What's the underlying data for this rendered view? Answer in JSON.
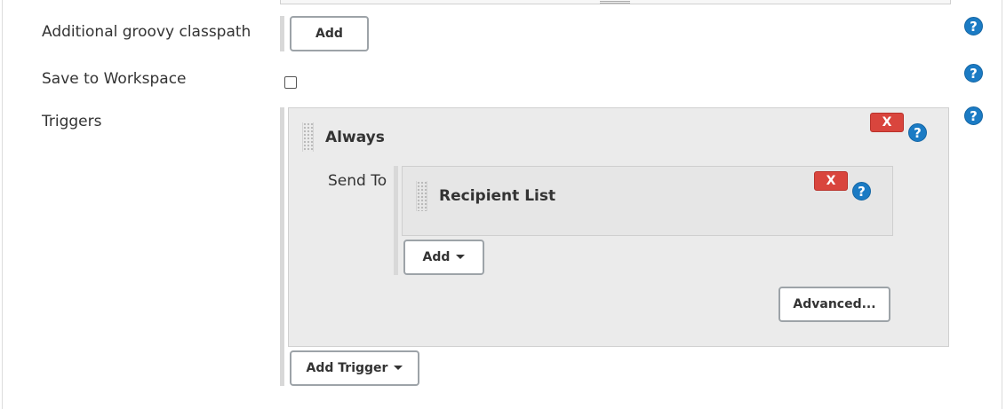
{
  "rows": {
    "groovy_classpath": {
      "label": "Additional groovy classpath",
      "add_label": "Add"
    },
    "save_to_workspace": {
      "label": "Save to Workspace",
      "checked": false
    },
    "triggers": {
      "label": "Triggers",
      "add_trigger_label": "Add Trigger"
    }
  },
  "trigger": {
    "title": "Always",
    "delete_label": "X",
    "send_to_label": "Send To",
    "recipient": {
      "title": "Recipient List",
      "delete_label": "X"
    },
    "add_label": "Add",
    "advanced_label": "Advanced..."
  },
  "help_glyph": "?",
  "colors": {
    "help_blue": "#1b7bc4",
    "delete_red": "#d9453d",
    "panel_bg": "#ebebeb",
    "button_border": "#9da3a8"
  }
}
